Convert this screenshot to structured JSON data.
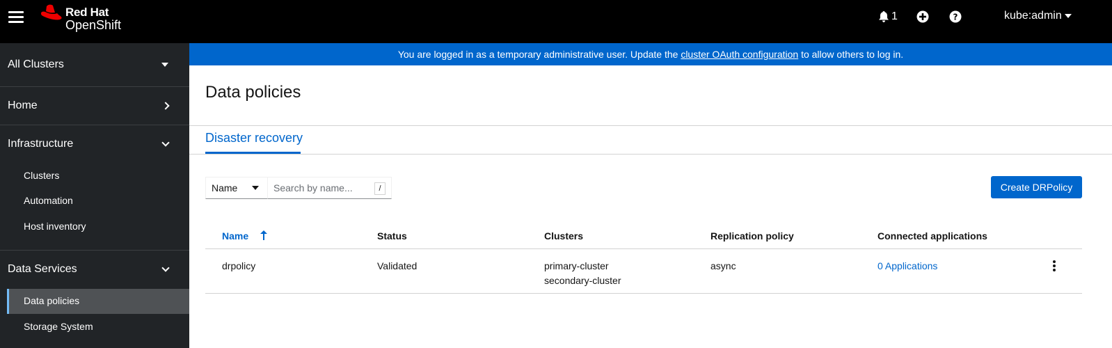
{
  "masthead": {
    "brand_top": "Red Hat",
    "brand_bottom": "OpenShift",
    "notification_count": "1",
    "user": "kube:admin",
    "icons": [
      "menu-icon",
      "bell-icon",
      "plus-circle-icon",
      "help-icon"
    ]
  },
  "banner": {
    "text_before": "You are logged in as a temporary administrative user. Update the ",
    "link": "cluster OAuth configuration",
    "text_after": " to allow others to log in."
  },
  "sidebar": {
    "cluster_selector": "All Clusters",
    "sections": [
      {
        "label": "Home",
        "expanded": false
      },
      {
        "label": "Infrastructure",
        "expanded": true,
        "items": [
          "Clusters",
          "Automation",
          "Host inventory"
        ]
      },
      {
        "label": "Data Services",
        "expanded": true,
        "items": [
          "Data policies",
          "Storage System"
        ]
      }
    ],
    "active_item": "Data policies"
  },
  "main": {
    "title": "Data policies",
    "tabs": [
      {
        "label": "Disaster recovery",
        "active": true
      }
    ],
    "filter": {
      "type": "Name",
      "placeholder": "Search by name...",
      "shortcut": "/"
    },
    "create_button": "Create DRPolicy",
    "table": {
      "columns": [
        "Name",
        "Status",
        "Clusters",
        "Replication policy",
        "Connected applications"
      ],
      "sorted_column": "Name",
      "rows": [
        {
          "name": "drpolicy",
          "status": "Validated",
          "clusters": [
            "primary-cluster",
            "secondary-cluster"
          ],
          "replication_policy": "async",
          "connected_applications": "0 Applications"
        }
      ]
    }
  },
  "colors": {
    "masthead": "#000000",
    "sidebar": "#212427",
    "banner": "#0066cc",
    "link": "#0066cc",
    "brand_red": "#ee0000"
  }
}
